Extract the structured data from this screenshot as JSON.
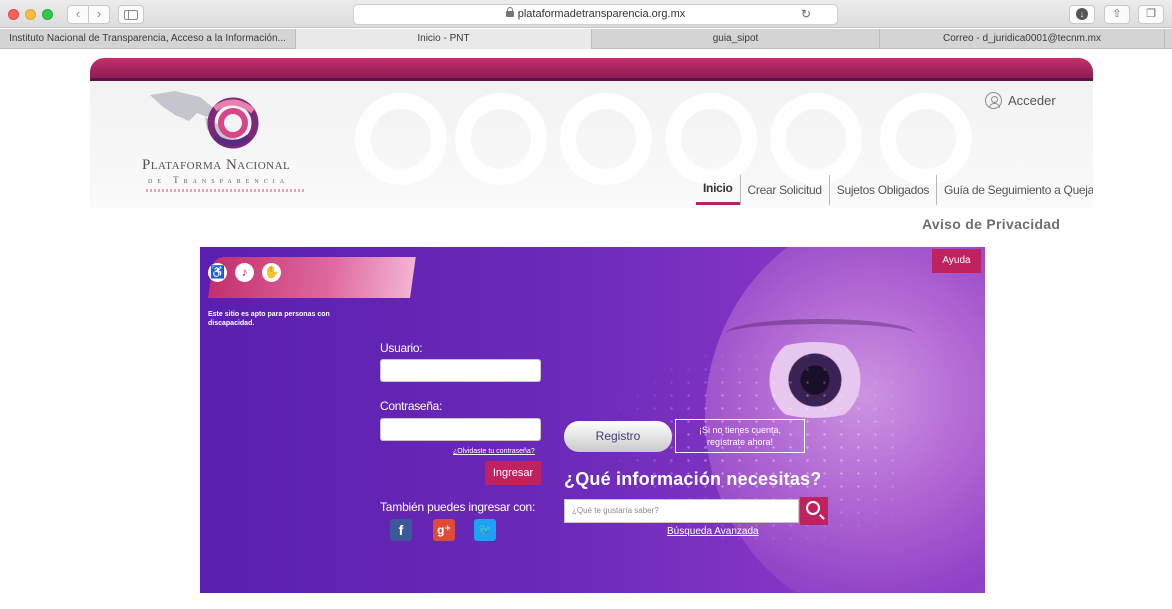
{
  "browser": {
    "url": "plataformadetransparencia.org.mx",
    "tabs": [
      {
        "label": "Instituto Nacional de Transparencia, Acceso a la Información..."
      },
      {
        "label": "Inicio - PNT"
      },
      {
        "label": "guia_sipot"
      },
      {
        "label": "Correo - d_juridica0001@tecnm.mx"
      }
    ]
  },
  "header": {
    "logo_line1": "Plataforma Nacional",
    "logo_line2": "de Transparencia",
    "acceder": "Acceder",
    "nav": [
      {
        "label": "Inicio"
      },
      {
        "label": "Crear Solicitud"
      },
      {
        "label": "Sujetos Obligados"
      },
      {
        "label": "Guía de Seguimiento a Quejas"
      }
    ],
    "aviso": "Aviso de Privacidad"
  },
  "hero": {
    "accessibility_text": "Este sitio es apto para personas con discapacidad.",
    "usuario_label": "Usuario:",
    "contrasena_label": "Contraseña:",
    "forgot": "¿Olvidaste tu contraseña?",
    "ingresar": "Ingresar",
    "tambien": "También puedes ingresar con:",
    "registro": "Registro",
    "sinotienes_1": "¡Si no tienes cuenta,",
    "sinotienes_2": "regístrate ahora!",
    "pregunta": "¿Qué información necesitas?",
    "search_placeholder": "¿Qué te gustaría saber?",
    "busqueda": "Búsqueda Avanzada",
    "ayuda": "Ayuda"
  },
  "colors": {
    "brand_magenta": "#c0225f",
    "hero_purple": "#6b29b8"
  }
}
